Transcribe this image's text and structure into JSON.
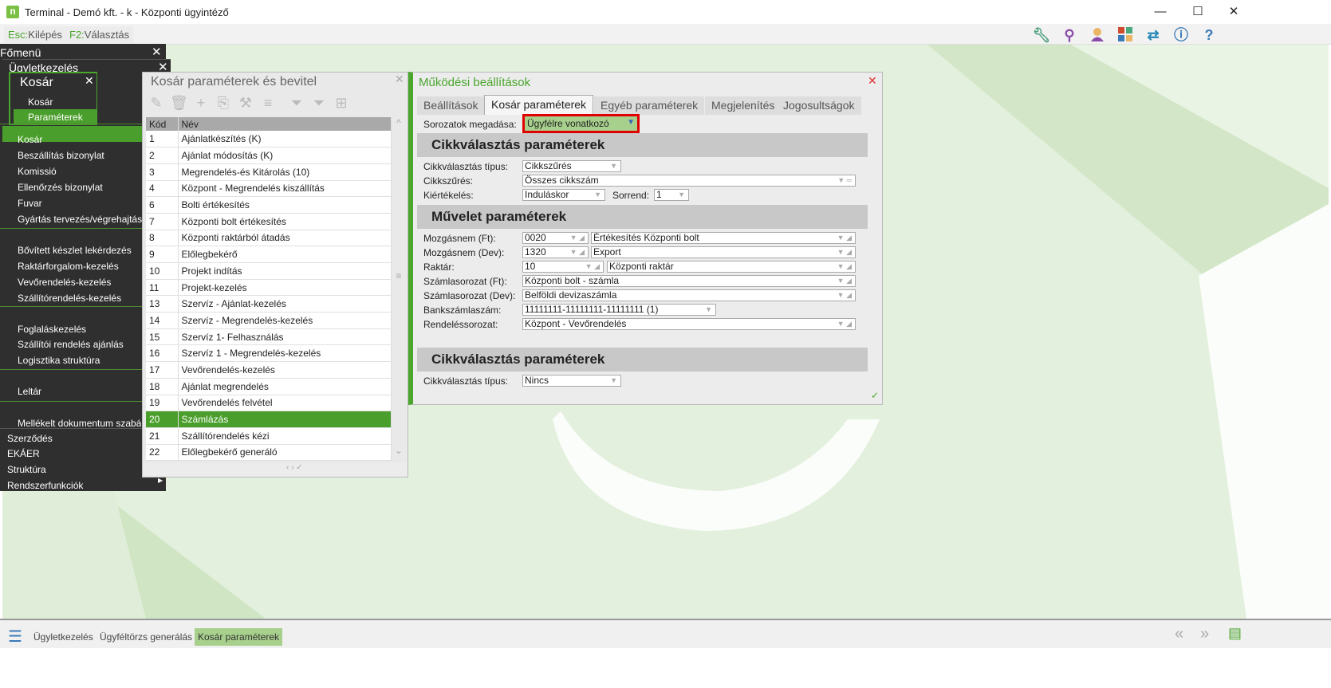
{
  "window": {
    "title": "Terminal - Demó kft. - k - Központi ügyintéző",
    "logo": "n",
    "min": "—",
    "max": "☐",
    "close": "✕"
  },
  "toolbar": {
    "esc_key": "Esc:",
    "esc_label": "Kilépés",
    "f2_key": "F2:",
    "f2_label": "Választás",
    "icons": [
      "wrench-icon",
      "search-icon",
      "user-icon",
      "tiles-icon",
      "swap-icon",
      "info-icon",
      "help-icon"
    ]
  },
  "menu": {
    "fomenu": "Főmenü",
    "ugyletkezeles": "Ügyletkezelés",
    "kosar_popup": {
      "title": "Kosár",
      "items": [
        "Kosár",
        "Paraméterek"
      ]
    },
    "items": [
      "Kosár",
      "Beszállítás bizonylat",
      "Komissió",
      "Ellenőrzés bizonylat",
      "Fuvar",
      "Gyártás tervezés/végrehajtás",
      "Bővített készlet lekérdezés",
      "Raktárforgalom-kezelés",
      "Vevőrendelés-kezelés",
      "Szállítórendelés-kezelés",
      "Foglaláskezelés",
      "Szállítói rendelés ajánlás",
      "Logisztika struktúra",
      "Leltár",
      "Mellékelt dokumentum szabályok"
    ],
    "bottom_items": [
      "Szerződés",
      "EKÁER",
      "Struktúra",
      "Rendszerfunkciók"
    ]
  },
  "list_panel": {
    "title": "Kosár paraméterek és bevitel",
    "columns": [
      "Kód",
      "Név"
    ],
    "rows": [
      [
        "1",
        "Ajánlatkészítés (K)"
      ],
      [
        "2",
        "Ajánlat módosítás (K)"
      ],
      [
        "3",
        "Megrendelés-és Kitárolás (10)"
      ],
      [
        "4",
        "Központ - Megrendelés kiszállítás"
      ],
      [
        "6",
        "Bolti értékesítés"
      ],
      [
        "7",
        "Központi bolt értékesítés"
      ],
      [
        "8",
        "Központi raktárból átadás"
      ],
      [
        "9",
        "Előlegbekérő"
      ],
      [
        "10",
        "Projekt indítás"
      ],
      [
        "11",
        "Projekt-kezelés"
      ],
      [
        "13",
        "Szervíz - Ajánlat-kezelés"
      ],
      [
        "14",
        "Szervíz - Megrendelés-kezelés"
      ],
      [
        "15",
        "Szervíz 1- Felhasználás"
      ],
      [
        "16",
        "Szervíz 1 - Megrendelés-kezelés"
      ],
      [
        "17",
        "Vevőrendelés-kezelés"
      ],
      [
        "18",
        "Ajánlat megrendelés"
      ],
      [
        "19",
        "Vevőrendelés felvétel"
      ],
      [
        "20",
        "Számlázás"
      ],
      [
        "21",
        "Szállítórendelés kézi"
      ],
      [
        "22",
        "Előlegbekérő generáló"
      ]
    ],
    "selected": "20"
  },
  "settings": {
    "title": "Működési beállítások",
    "tabs": [
      "Beállítások",
      "Kosár paraméterek",
      "Egyéb paraméterek",
      "Megjelenítés",
      "Jogosultságok"
    ],
    "active_tab": 1,
    "sorozatok_label": "Sorozatok megadása:",
    "sorozatok_value": "Ügyfélre vonatkozó",
    "sec1": "Cikkválasztás paraméterek",
    "cikkvalasztas_tipus_label": "Cikkválasztás típus:",
    "cikkvalasztas_tipus": "Cikkszűrés",
    "cikkszures_label": "Cikkszűrés:",
    "cikkszures": "Összes cikkszám",
    "kiertekeles_label": "Kiértékelés:",
    "kiertekeles": "Induláskor",
    "sorrend_label": "Sorrend:",
    "sorrend": "1",
    "sec2": "Művelet paraméterek",
    "mozg_ft_label": "Mozgásnem (Ft):",
    "mozg_ft_code": "0020",
    "mozg_ft_name": "Értékesítés Központi bolt",
    "mozg_dev_label": "Mozgásnem (Dev):",
    "mozg_dev_code": "1320",
    "mozg_dev_name": "Export",
    "raktar_label": "Raktár:",
    "raktar_code": "10",
    "raktar_name": "Központi raktár",
    "szsor_ft_label": "Számlasorozat (Ft):",
    "szsor_ft": "Központi bolt - számla",
    "szsor_dev_label": "Számlasorozat (Dev):",
    "szsor_dev": "Belföldi devizaszámla",
    "bank_label": "Bankszámlaszám:",
    "bank": "11111111-11111111-11111111 (1)",
    "rend_label": "Rendeléssorozat:",
    "rend": "Központ - Vevőrendelés",
    "sec3": "Cikkválasztás paraméterek",
    "cikk2_label": "Cikkválasztás típus:",
    "cikk2": "Nincs"
  },
  "taskbar": {
    "items": [
      "Ügyletkezelés",
      "Ügyféltörzs generálás",
      "Kosár paraméterek"
    ],
    "active": 2
  }
}
